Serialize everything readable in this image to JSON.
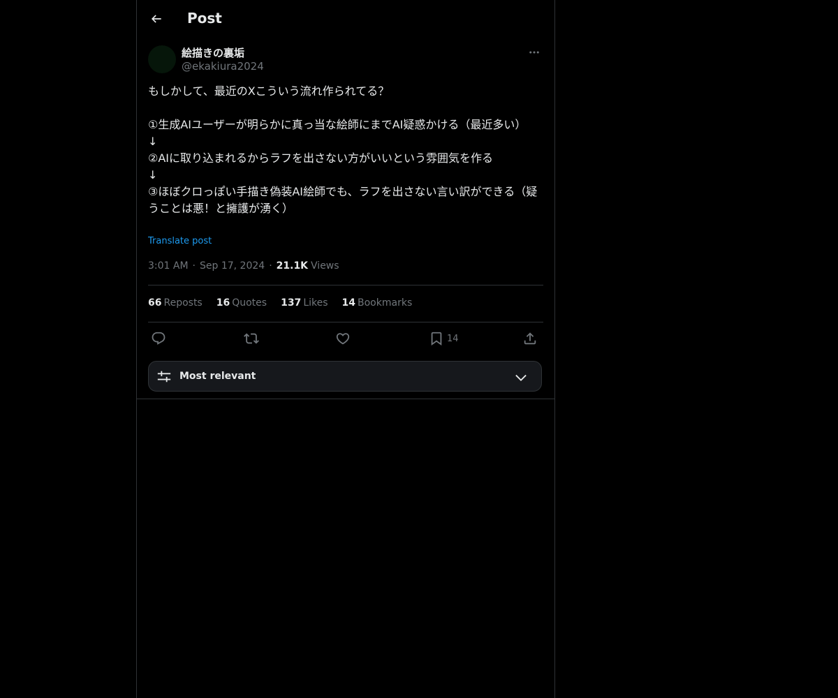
{
  "header": {
    "title": "Post",
    "back_icon": "arrow-left-icon"
  },
  "post": {
    "author": {
      "display_name": "絵描きの裏垢",
      "handle": "@ekakiura2024"
    },
    "text": "もしかして、最近のXこういう流れ作られてる？\n\n①生成AIユーザーが明らかに真っ当な絵師にまでAI疑惑かける（最近多い）\n↓\n②AIに取り込まれるからラフを出さない方がいいという雰囲気を作る\n↓\n③ほぼクロっぽい手描き偽装AI絵師でも、ラフを出さない言い訳ができる（疑うことは悪！と擁護が湧く）",
    "translate_label": "Translate post",
    "time": "3:01 AM",
    "date": "Sep 17, 2024",
    "views_count": "21.1K",
    "views_label": "Views",
    "separator": "·"
  },
  "stats": {
    "reposts_count": "66",
    "reposts_label": "Reposts",
    "quotes_count": "16",
    "quotes_label": "Quotes",
    "likes_count": "137",
    "likes_label": "Likes",
    "bookmarks_count": "14",
    "bookmarks_label": "Bookmarks"
  },
  "actions": {
    "reply_icon": "reply-icon",
    "repost_icon": "repost-icon",
    "like_icon": "heart-icon",
    "bookmark_icon": "bookmark-icon",
    "bookmark_count": "14",
    "share_icon": "share-icon"
  },
  "sort": {
    "selected": "Most relevant"
  },
  "colors": {
    "background": "#000000",
    "text_primary": "#e7e9ea",
    "text_secondary": "#71767b",
    "accent": "#1d9bf0",
    "border": "#2f3336"
  }
}
